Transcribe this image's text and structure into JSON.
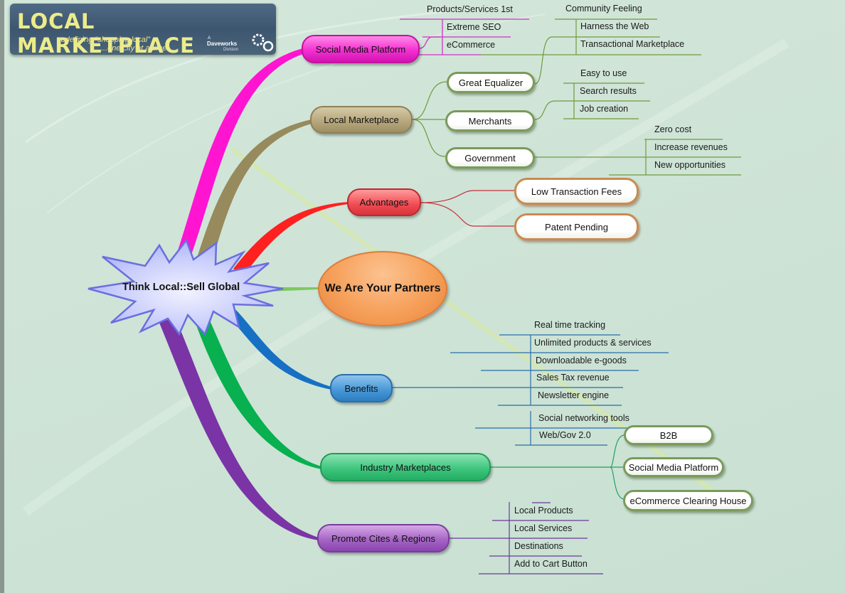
{
  "logo": {
    "title": "LOCAL MARKETPLACE",
    "tagline_line1": "redefining “shopping local”",
    "tagline_line2": "...one city at a time",
    "division_a": "A",
    "division_brand": "Daveworks",
    "division_word": "Division",
    "icon": "gears-icon"
  },
  "colors": {
    "background": "#cfe4d7",
    "social": "#f52fd3",
    "local": "#9e8e63",
    "advantages": "#e8343c",
    "partners": "#f6a05a",
    "benefits": "#2a6ea8",
    "industry": "#23ad63",
    "promote": "#7a3b9e",
    "center": "#c8cdf8"
  },
  "center": {
    "label": "Think Local::Sell Global"
  },
  "branches": {
    "social": {
      "label": "Social Media Platform",
      "children": [
        "Products/Services 1st",
        "Extreme SEO",
        "eCommerce"
      ]
    },
    "local": {
      "label": "Local Marketplace",
      "children": [
        {
          "label": "Great Equalizer",
          "children": [
            "Community Feeling",
            "Harness the Web",
            "Transactional Marketplace"
          ]
        },
        {
          "label": "Merchants",
          "children": [
            "Easy to use",
            "Search results",
            "Job creation"
          ]
        },
        {
          "label": "Government",
          "children": [
            "Zero cost",
            "Increase revenues",
            "New opportunities"
          ]
        }
      ]
    },
    "advantages": {
      "label": "Advantages",
      "children": [
        "Low Transaction Fees",
        "Patent Pending"
      ]
    },
    "partners": {
      "label": "We Are Your Partners"
    },
    "benefits": {
      "label": "Benefits",
      "children": [
        "Real time tracking",
        "Unlimited products & services",
        "Downloadable e-goods",
        "Sales Tax revenue",
        "Newsletter engine",
        "Social networking tools",
        "Web/Gov 2.0"
      ]
    },
    "industry": {
      "label": "Industry Marketplaces",
      "children": [
        "B2B",
        "Social Media Platform",
        "eCommerce Clearing House"
      ]
    },
    "promote": {
      "label": "Promote Cites & Regions",
      "children": [
        "Local Products",
        "Local Services",
        "Destinations",
        "Add to Cart Button"
      ]
    }
  }
}
